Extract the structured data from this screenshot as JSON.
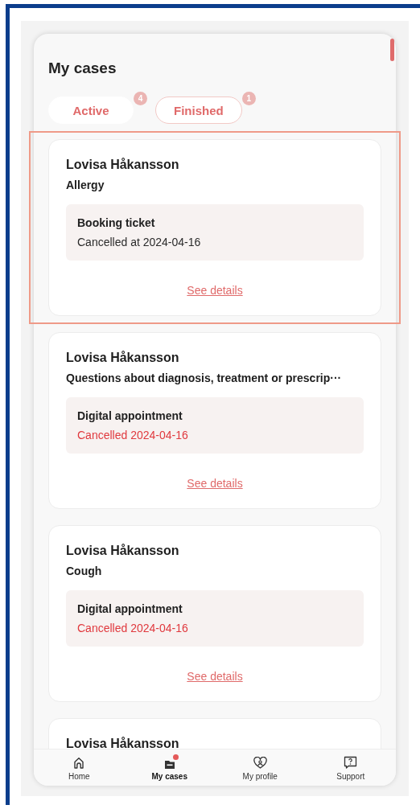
{
  "title": "My cases",
  "tabs": [
    {
      "label": "Active",
      "count": "4",
      "selected": true
    },
    {
      "label": "Finished",
      "count": "1",
      "selected": false
    }
  ],
  "cases": [
    {
      "name": "Lovisa Håkansson",
      "topic": "Allergy",
      "booking": "Booking ticket",
      "status": "Cancelled at 2024-04-16",
      "kind": "neutral",
      "highlighted": true,
      "link": "See details"
    },
    {
      "name": "Lovisa Håkansson",
      "topic": "Questions about diagnosis, treatment or prescrip···",
      "booking": "Digital appointment",
      "status": "Cancelled 2024-04-16",
      "kind": "alert",
      "highlighted": false,
      "link": "See details"
    },
    {
      "name": "Lovisa Håkansson",
      "topic": "Cough",
      "booking": "Digital appointment",
      "status": "Cancelled 2024-04-16",
      "kind": "alert",
      "highlighted": false,
      "link": "See details"
    },
    {
      "name": "Lovisa Håkansson",
      "kind": "partial",
      "highlighted": false
    }
  ],
  "nav": [
    {
      "label": "Home",
      "selected": false,
      "dot": false
    },
    {
      "label": "My cases",
      "selected": true,
      "dot": true
    },
    {
      "label": "My profile",
      "selected": false,
      "dot": false
    },
    {
      "label": "Support",
      "selected": false,
      "dot": false
    }
  ]
}
